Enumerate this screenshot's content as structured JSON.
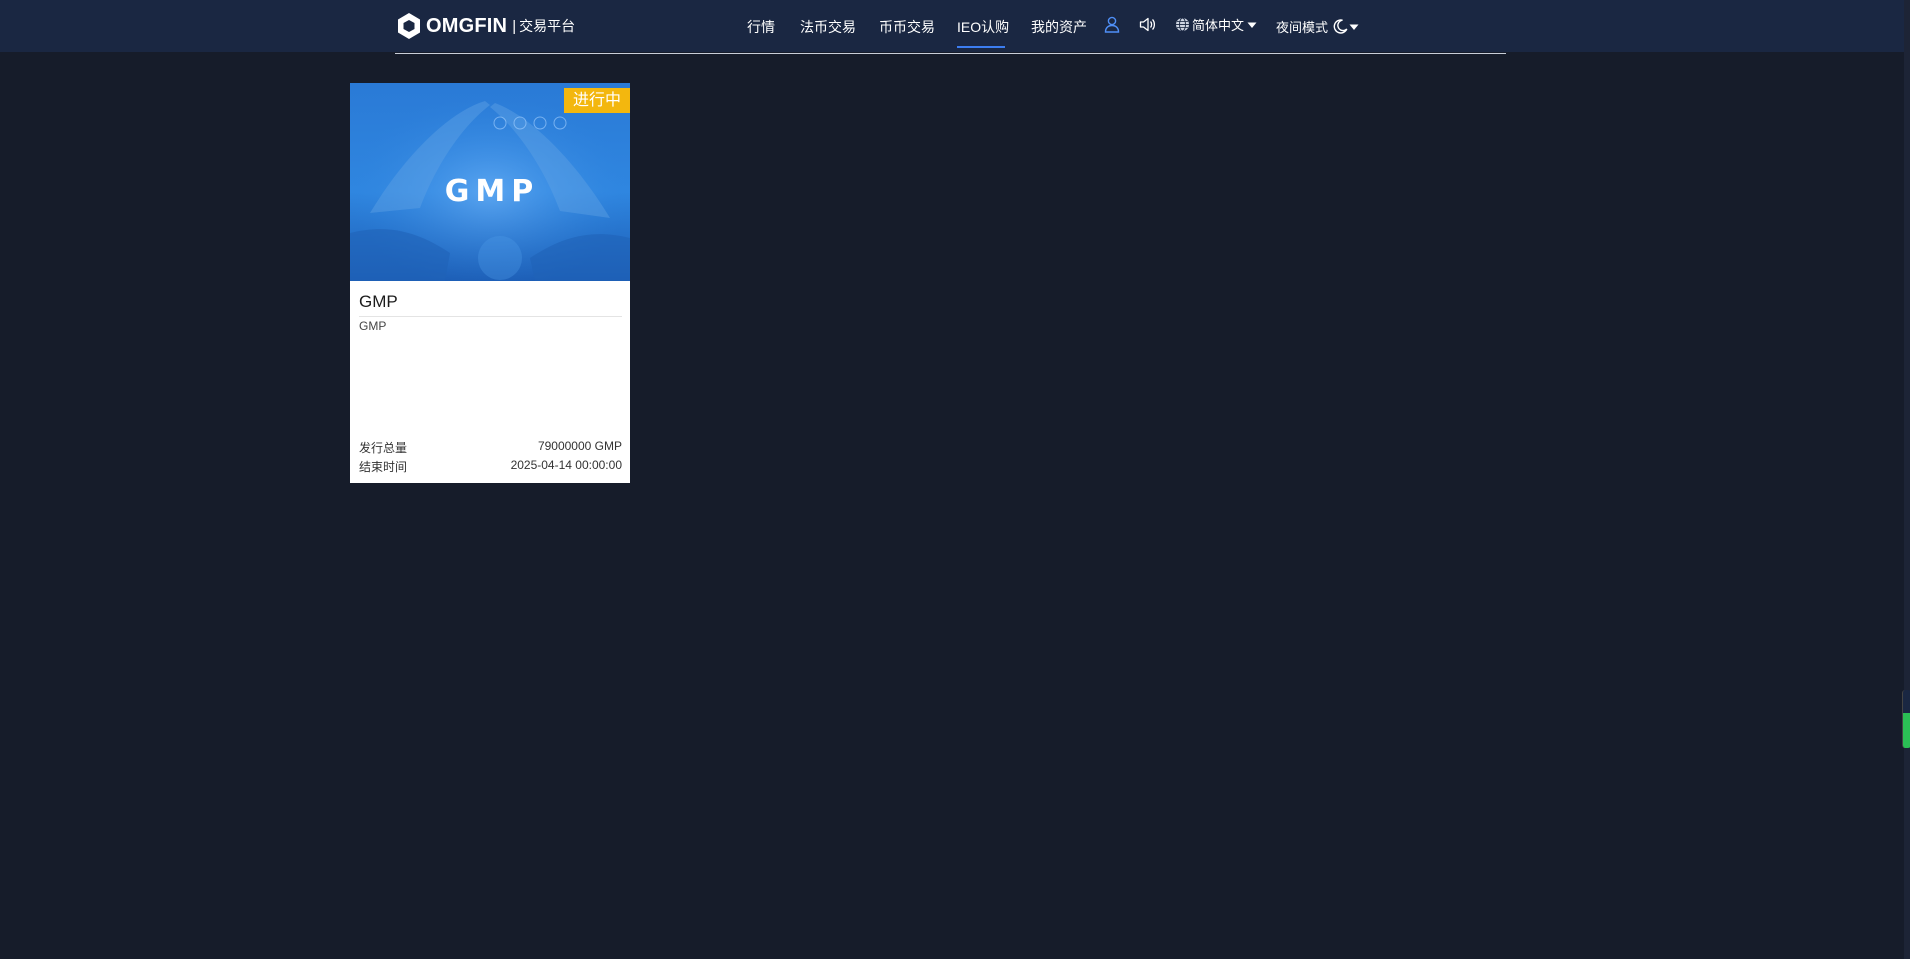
{
  "header": {
    "brand": "OMGFIN",
    "separator": "|",
    "subtitle": "交易平台",
    "nav": [
      {
        "label": "行情"
      },
      {
        "label": "法币交易"
      },
      {
        "label": "币币交易"
      },
      {
        "label": "IEO认购"
      },
      {
        "label": "我的资产"
      }
    ],
    "active_nav": "IEO认购",
    "language": "简体中文",
    "night_mode": "夜间模式"
  },
  "icons": {
    "user": "user-icon",
    "sound": "speaker-icon",
    "globe": "globe-icon",
    "moon": "moon-icon",
    "dropdown": "caret-down-icon"
  },
  "colors": {
    "background": "#161c2a",
    "topbar": "#1a2742",
    "accent": "#3c7df0",
    "badge": "#f3b70e"
  },
  "projects": [
    {
      "image_text": "GMP",
      "status": "进行中",
      "title": "GMP",
      "description": "GMP",
      "total_label": "发行总量",
      "total_value": "79000000 GMP",
      "end_label": "结束时间",
      "end_value": "2025-04-14 00:00:00"
    }
  ]
}
